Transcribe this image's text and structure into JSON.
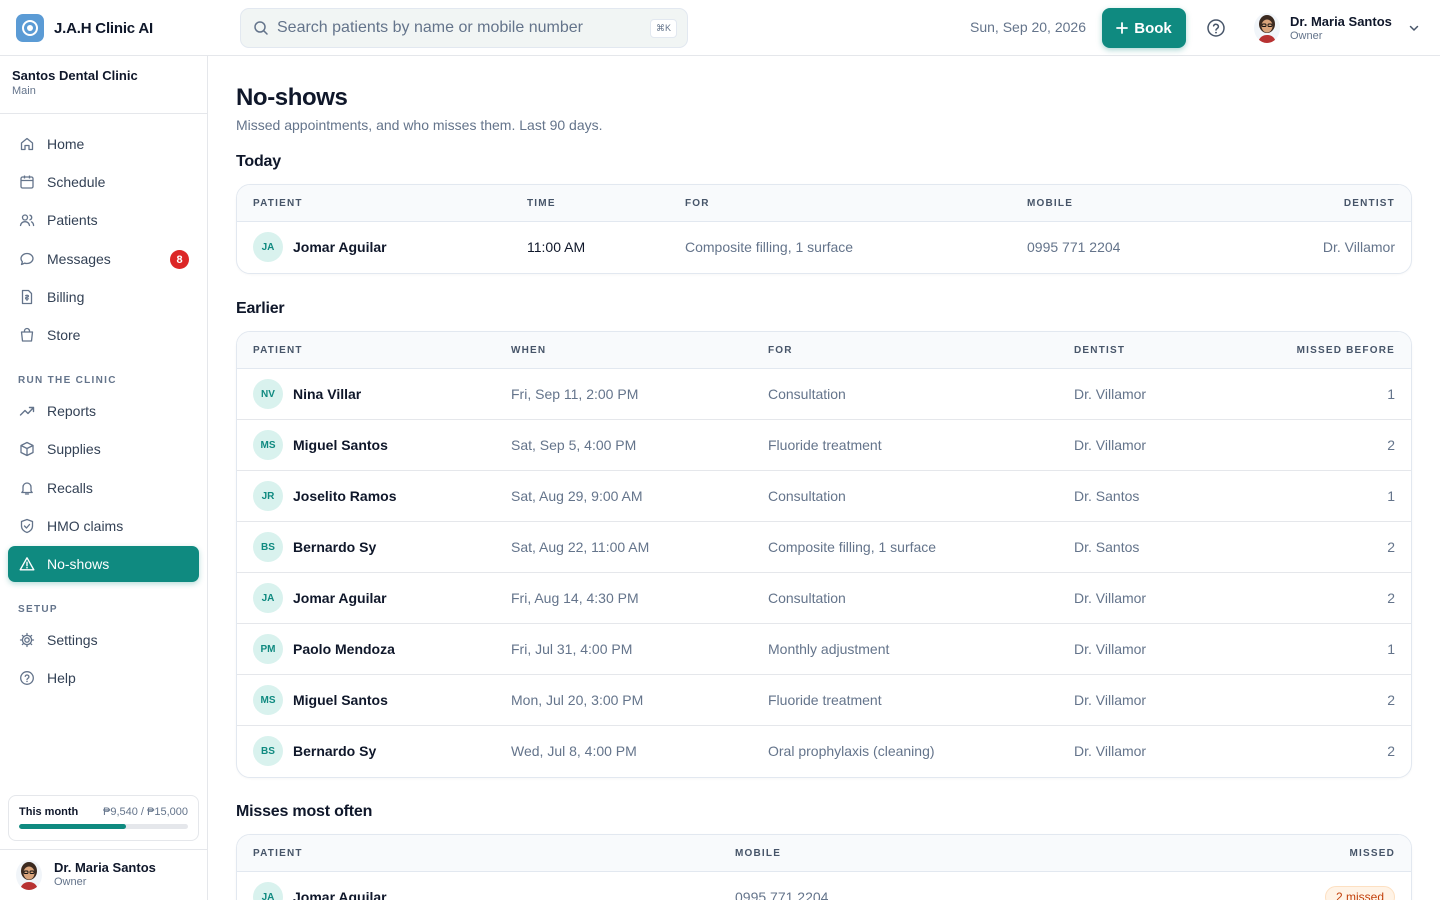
{
  "app": {
    "name": "J.A.H Clinic AI"
  },
  "search": {
    "placeholder": "Search patients by name or mobile number",
    "shortcut": "⌘K"
  },
  "header": {
    "date": "Sun, Sep 20, 2026",
    "book_label": "Book"
  },
  "user": {
    "name": "Dr. Maria Santos",
    "role": "Owner"
  },
  "clinic": {
    "name": "Santos Dental Clinic",
    "branch": "Main"
  },
  "sidebar": {
    "items": [
      {
        "label": "Home",
        "icon": "home-icon"
      },
      {
        "label": "Schedule",
        "icon": "calendar-icon"
      },
      {
        "label": "Patients",
        "icon": "users-icon"
      },
      {
        "label": "Messages",
        "icon": "message-icon",
        "badge": "8"
      },
      {
        "label": "Billing",
        "icon": "receipt-icon"
      },
      {
        "label": "Store",
        "icon": "bag-icon"
      }
    ],
    "section_run": "RUN THE CLINIC",
    "run_items": [
      {
        "label": "Reports",
        "icon": "trend-icon"
      },
      {
        "label": "Supplies",
        "icon": "box-icon"
      },
      {
        "label": "Recalls",
        "icon": "bell-icon"
      },
      {
        "label": "HMO claims",
        "icon": "shield-icon"
      },
      {
        "label": "No-shows",
        "icon": "alert-triangle-icon",
        "active": true
      }
    ],
    "section_setup": "SETUP",
    "setup_items": [
      {
        "label": "Settings",
        "icon": "gear-icon"
      },
      {
        "label": "Help",
        "icon": "help-icon"
      }
    ]
  },
  "budget": {
    "label": "This month",
    "value": "₱9,540 / ₱15,000",
    "progress": 0.636
  },
  "page": {
    "title": "No-shows",
    "subtitle": "Missed appointments, and who misses them. Last 90 days."
  },
  "today": {
    "heading": "Today",
    "columns": [
      "PATIENT",
      "TIME",
      "FOR",
      "MOBILE",
      "DENTIST"
    ],
    "rows": [
      {
        "initials": "JA",
        "name": "Jomar Aguilar",
        "time": "11:00 AM",
        "for": "Composite filling, 1 surface",
        "mobile": "0995 771 2204",
        "dentist": "Dr. Villamor"
      }
    ]
  },
  "earlier": {
    "heading": "Earlier",
    "columns": [
      "PATIENT",
      "WHEN",
      "FOR",
      "DENTIST",
      "MISSED BEFORE"
    ],
    "rows": [
      {
        "initials": "NV",
        "name": "Nina Villar",
        "when": "Fri, Sep 11, 2:00 PM",
        "for": "Consultation",
        "dentist": "Dr. Villamor",
        "missed": "1"
      },
      {
        "initials": "MS",
        "name": "Miguel Santos",
        "when": "Sat, Sep 5, 4:00 PM",
        "for": "Fluoride treatment",
        "dentist": "Dr. Villamor",
        "missed": "2"
      },
      {
        "initials": "JR",
        "name": "Joselito Ramos",
        "when": "Sat, Aug 29, 9:00 AM",
        "for": "Consultation",
        "dentist": "Dr. Santos",
        "missed": "1"
      },
      {
        "initials": "BS",
        "name": "Bernardo Sy",
        "when": "Sat, Aug 22, 11:00 AM",
        "for": "Composite filling, 1 surface",
        "dentist": "Dr. Santos",
        "missed": "2"
      },
      {
        "initials": "JA",
        "name": "Jomar Aguilar",
        "when": "Fri, Aug 14, 4:30 PM",
        "for": "Consultation",
        "dentist": "Dr. Villamor",
        "missed": "2"
      },
      {
        "initials": "PM",
        "name": "Paolo Mendoza",
        "when": "Fri, Jul 31, 4:00 PM",
        "for": "Monthly adjustment",
        "dentist": "Dr. Villamor",
        "missed": "1"
      },
      {
        "initials": "MS",
        "name": "Miguel Santos",
        "when": "Mon, Jul 20, 3:00 PM",
        "for": "Fluoride treatment",
        "dentist": "Dr. Villamor",
        "missed": "2"
      },
      {
        "initials": "BS",
        "name": "Bernardo Sy",
        "when": "Wed, Jul 8, 4:00 PM",
        "for": "Oral prophylaxis (cleaning)",
        "dentist": "Dr. Villamor",
        "missed": "2"
      }
    ]
  },
  "often": {
    "heading": "Misses most often",
    "columns": [
      "PATIENT",
      "MOBILE",
      "MISSED"
    ],
    "rows": [
      {
        "initials": "JA",
        "name": "Jomar Aguilar",
        "mobile": "0995 771 2204",
        "missed": "2 missed"
      }
    ]
  },
  "colors": {
    "accent": "#0f8a80",
    "badge": "#dc2626",
    "brand_logo": "#5b9bd5"
  }
}
